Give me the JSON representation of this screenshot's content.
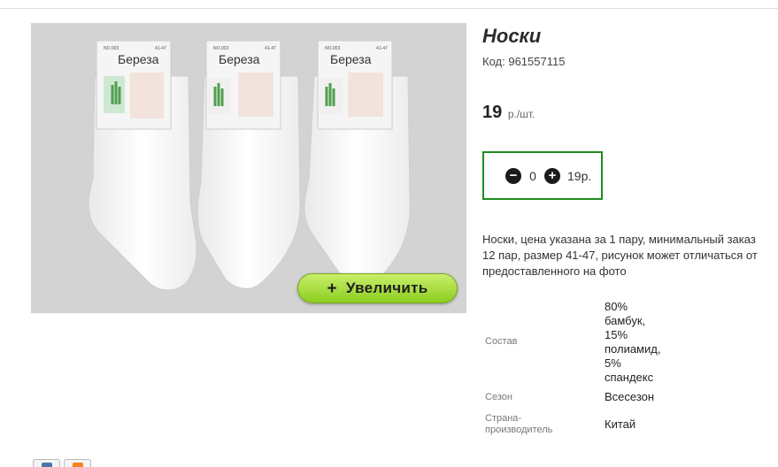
{
  "product": {
    "title": "Носки",
    "code_label": "Код:",
    "code": "961557115",
    "price": "19",
    "price_unit": "р./шт."
  },
  "photo": {
    "brand_label": "Береза",
    "size_label": "41-47",
    "tag_small": "NO.003",
    "zoom_label": "Увеличить",
    "zoom_plus": "+"
  },
  "quantity": {
    "minus": "−",
    "value": "0",
    "plus": "+",
    "total": "19р."
  },
  "description": "Носки, цена указана за 1 пару, минимальный заказ 12 пар, размер 41-47, рисунок может отличаться от предоставленного на фото",
  "specs": {
    "composition_label": "Состав",
    "composition_lines": [
      "80%",
      "бамбук,",
      "15%",
      "полиамид,",
      "5%",
      "спандекс"
    ],
    "season_label": "Сезон",
    "season_value": "Всесезон",
    "country_label_line1": "Страна-",
    "country_label_line2": "производитель",
    "country_value": "Китай"
  },
  "social": [
    "vk-icon",
    "odnoklassniki-icon"
  ],
  "colors": {
    "accent_green": "#1e8c1e",
    "zoom_button": "#a6dc3c",
    "photo_bg": "#d3d3d3"
  }
}
